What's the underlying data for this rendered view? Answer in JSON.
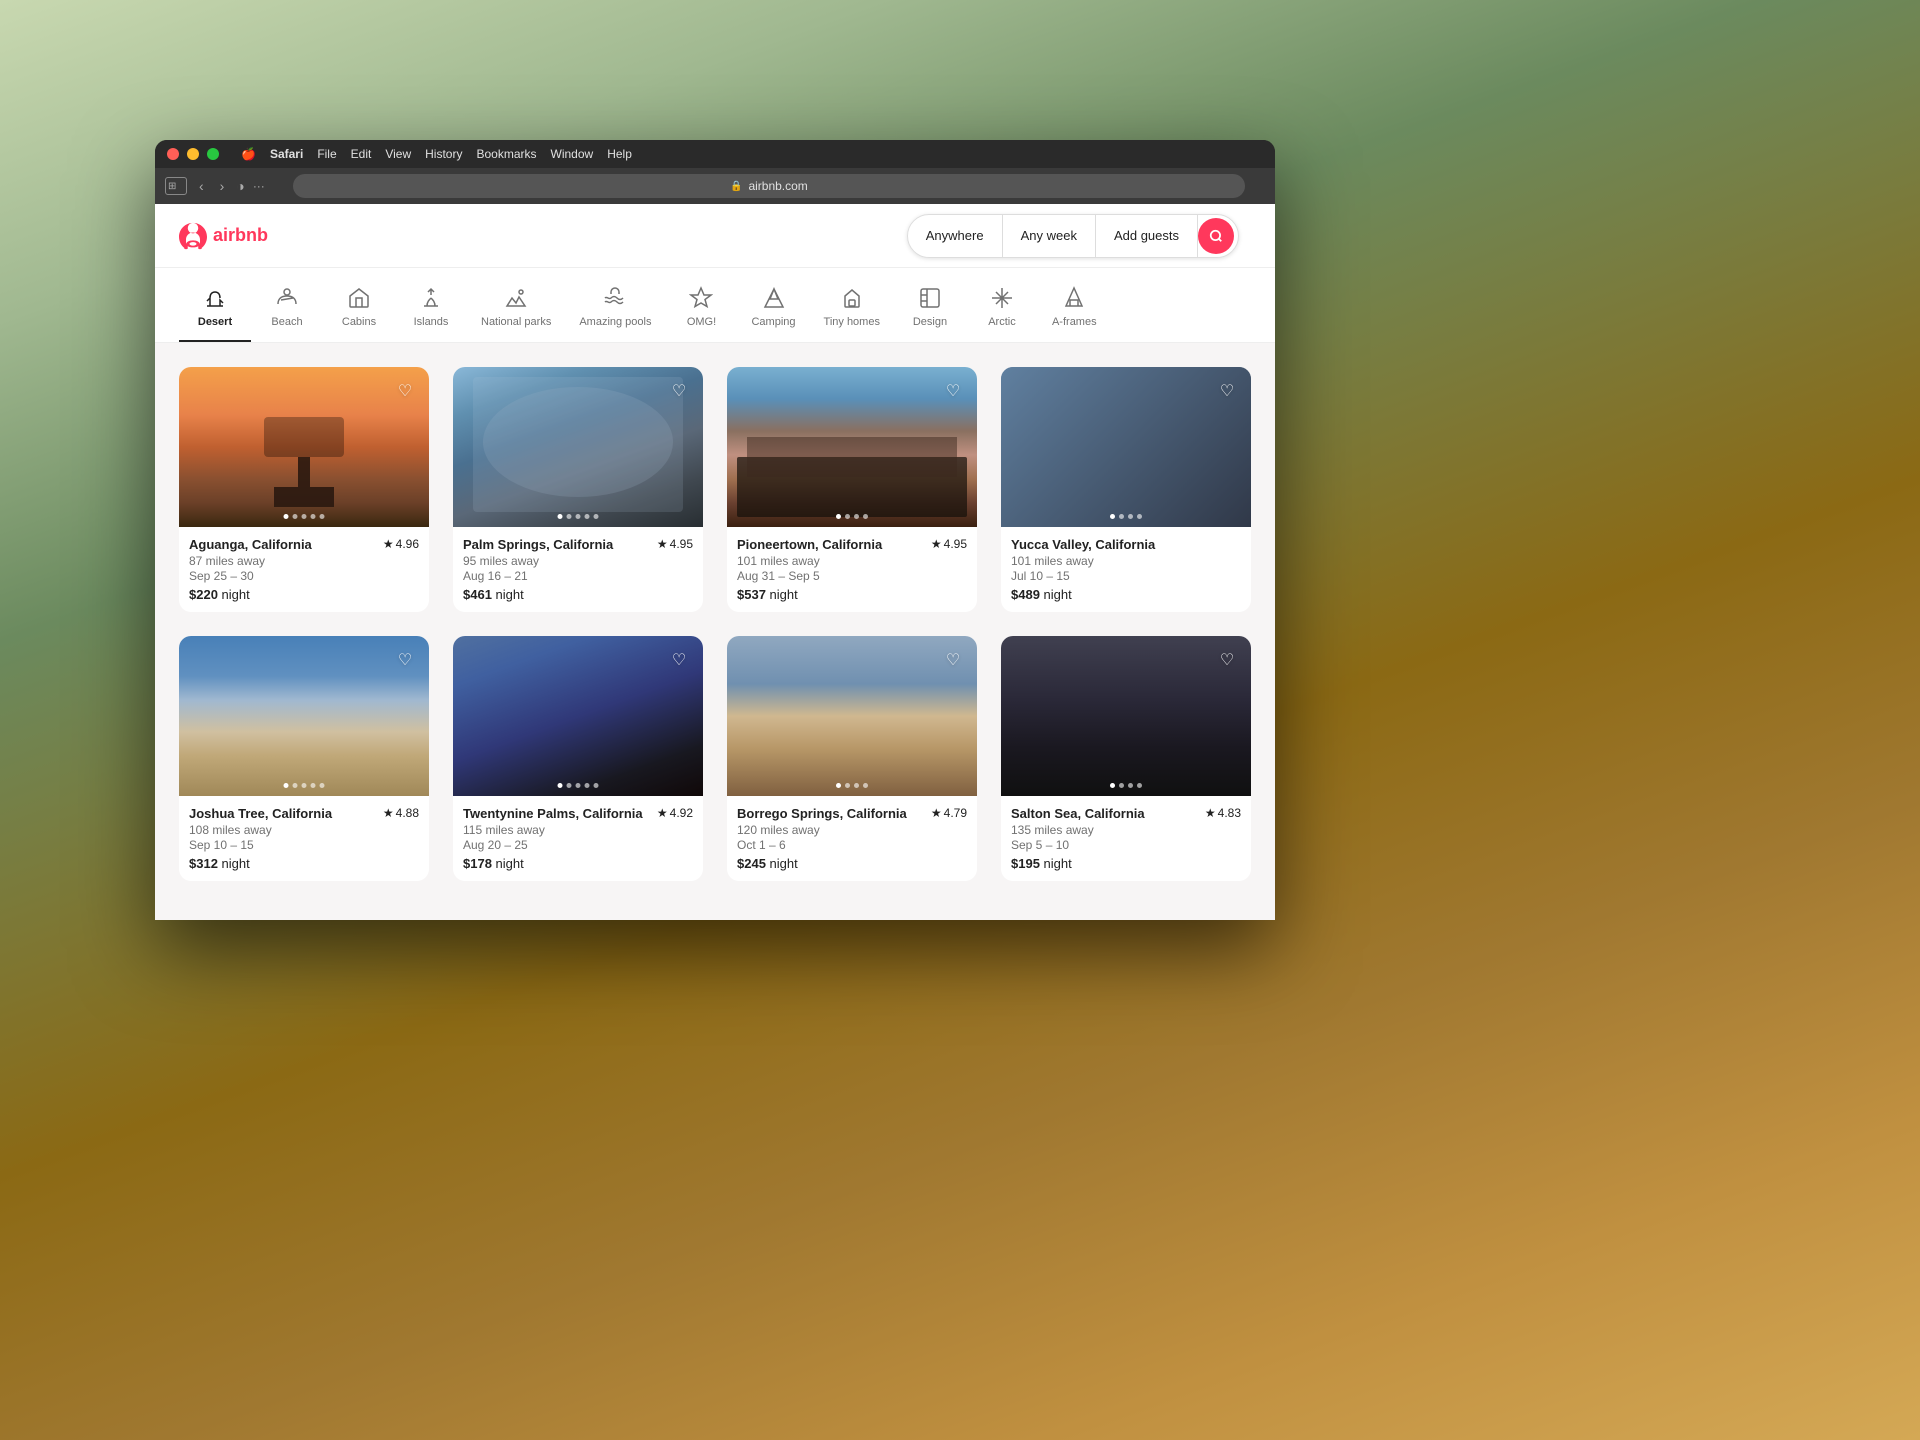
{
  "browser": {
    "os_icon": "🍎",
    "menu_items": [
      "Safari",
      "File",
      "Edit",
      "View",
      "History",
      "Bookmarks",
      "Window",
      "Help"
    ],
    "back_btn": "‹",
    "forward_btn": "›",
    "address": "airbnb.com",
    "privacy_dots": "···"
  },
  "airbnb": {
    "logo_text": "airbnb",
    "search": {
      "anywhere": "Anywhere",
      "any_week": "Any week",
      "add_guests": "Add guests"
    },
    "categories": [
      {
        "id": "desert",
        "label": "Desert",
        "active": true
      },
      {
        "id": "beach",
        "label": "Beach",
        "active": false
      },
      {
        "id": "cabins",
        "label": "Cabins",
        "active": false
      },
      {
        "id": "islands",
        "label": "Islands",
        "active": false
      },
      {
        "id": "national-parks",
        "label": "National parks",
        "active": false
      },
      {
        "id": "amazing-pools",
        "label": "Amazing pools",
        "active": false
      },
      {
        "id": "omg",
        "label": "OMG!",
        "active": false
      },
      {
        "id": "camping",
        "label": "Camping",
        "active": false
      },
      {
        "id": "tiny-homes",
        "label": "Tiny homes",
        "active": false
      },
      {
        "id": "design",
        "label": "Design",
        "active": false
      },
      {
        "id": "arctic",
        "label": "Arctic",
        "active": false
      },
      {
        "id": "a-frames",
        "label": "A-frames",
        "active": false
      }
    ],
    "listings": [
      {
        "id": 1,
        "location": "Aguanga, California",
        "distance": "87 miles away",
        "dates": "Sep 25 – 30",
        "price": "$220",
        "unit": "night",
        "rating": "4.96",
        "dots": 5,
        "active_dot": 0
      },
      {
        "id": 2,
        "location": "Palm Springs, California",
        "distance": "95 miles away",
        "dates": "Aug 16 – 21",
        "price": "$461",
        "unit": "night",
        "rating": "4.95",
        "dots": 5,
        "active_dot": 0
      },
      {
        "id": 3,
        "location": "Pioneertown, California",
        "distance": "101 miles away",
        "dates": "Aug 31 – Sep 5",
        "price": "$537",
        "unit": "night",
        "rating": "4.95",
        "dots": 4,
        "active_dot": 0
      },
      {
        "id": 4,
        "location": "Yucca Valley, California",
        "distance": "101 miles away",
        "dates": "Jul 10 – 15",
        "price": "$489",
        "unit": "night",
        "rating": "",
        "dots": 4,
        "active_dot": 0,
        "partial": true
      },
      {
        "id": 5,
        "location": "Joshua Tree, California",
        "distance": "108 miles away",
        "dates": "Sep 10 – 15",
        "price": "$312",
        "unit": "night",
        "rating": "4.88",
        "dots": 5,
        "active_dot": 0
      },
      {
        "id": 6,
        "location": "Twentynine Palms, California",
        "distance": "115 miles away",
        "dates": "Aug 20 – 25",
        "price": "$178",
        "unit": "night",
        "rating": "4.92",
        "dots": 5,
        "active_dot": 0
      },
      {
        "id": 7,
        "location": "Borrego Springs, California",
        "distance": "120 miles away",
        "dates": "Oct 1 – 6",
        "price": "$245",
        "unit": "night",
        "rating": "4.79",
        "dots": 4,
        "active_dot": 0
      },
      {
        "id": 8,
        "location": "Salton Sea, California",
        "distance": "135 miles away",
        "dates": "Sep 5 – 10",
        "price": "$195",
        "unit": "night",
        "rating": "4.83",
        "dots": 4,
        "active_dot": 0
      }
    ]
  }
}
